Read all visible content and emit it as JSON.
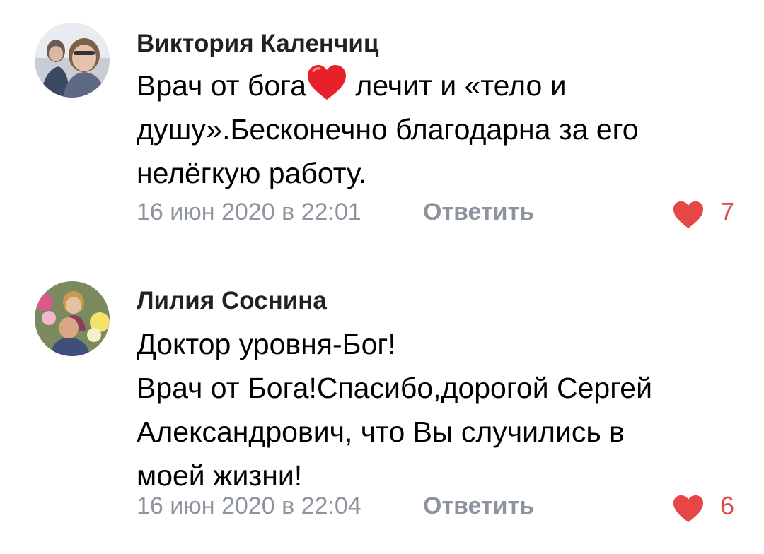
{
  "colors": {
    "like_red": "#e64646",
    "meta_gray": "#8e949d",
    "author_color": "#222222"
  },
  "comments": [
    {
      "author": "Виктория Каленчиц",
      "text_line1_before": "Врач от бога",
      "text_line1_after": "лечит и «тело и",
      "text_line2": "душу».Бесконечно благодарна за его",
      "text_line3": "нелёгкую работу.",
      "date": "16 июн 2020 в 22:01",
      "reply_label": "Ответить",
      "likes": "7",
      "inline_emoji": "red-heart-emoji"
    },
    {
      "author": "Лилия Соснина",
      "text_line1": "Доктор уровня-Бог!",
      "text_line2": "Врач от Бога!Спасибо,дорогой Сергей",
      "text_line3": "Александрович, что Вы случились в",
      "text_line4": "моей жизни!",
      "date": "16 июн 2020 в 22:04",
      "reply_label": "Ответить",
      "likes": "6"
    }
  ]
}
